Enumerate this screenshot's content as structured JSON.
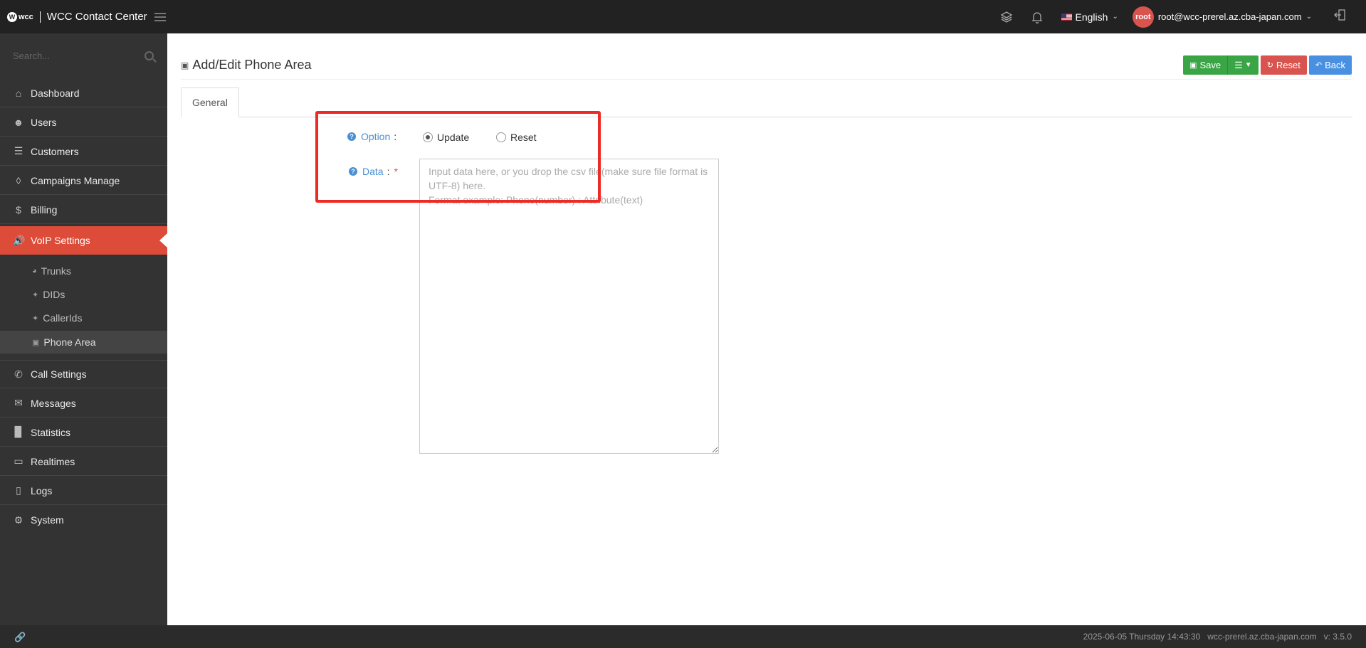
{
  "app": {
    "logo_text": "wcc",
    "title": "WCC Contact Center"
  },
  "topbar": {
    "language": "English",
    "avatar_text": "root",
    "user_email": "root@wcc-prerel.az.cba-japan.com"
  },
  "sidebar": {
    "search_placeholder": "Search...",
    "items": [
      {
        "label": "Dashboard",
        "icon": "home-icon"
      },
      {
        "label": "Users",
        "icon": "user-icon"
      },
      {
        "label": "Customers",
        "icon": "database-icon"
      },
      {
        "label": "Campaigns Manage",
        "icon": "layers-icon"
      },
      {
        "label": "Billing",
        "icon": "dollar-icon"
      },
      {
        "label": "VoIP Settings",
        "icon": "volume-icon",
        "active": true
      },
      {
        "label": "Call Settings",
        "icon": "phone-icon"
      },
      {
        "label": "Messages",
        "icon": "envelope-icon"
      },
      {
        "label": "Statistics",
        "icon": "bar-chart-icon"
      },
      {
        "label": "Realtimes",
        "icon": "monitor-icon"
      },
      {
        "label": "Logs",
        "icon": "book-icon"
      },
      {
        "label": "System",
        "icon": "gear-icon"
      }
    ],
    "subitems": [
      {
        "label": "Trunks",
        "icon": "tachometer-icon"
      },
      {
        "label": "DIDs",
        "icon": "crosshair-icon"
      },
      {
        "label": "CallerIds",
        "icon": "crosshair-icon"
      },
      {
        "label": "Phone Area",
        "icon": "book-icon",
        "active": true
      }
    ]
  },
  "page": {
    "title": "Add/Edit Phone Area",
    "buttons": {
      "save": "Save",
      "reset": "Reset",
      "back": "Back"
    },
    "tab": "General",
    "form": {
      "option_label": "Option",
      "option_values": [
        "Update",
        "Reset"
      ],
      "option_selected": "Update",
      "data_label": "Data",
      "data_required_mark": "*",
      "data_placeholder": "Input data here, or you drop the csv file(make sure file format is UTF-8) here.\nFormat example: Phone(number) : Attribute(text)"
    }
  },
  "footer": {
    "datetime": "2025-06-05 Thursday 14:43:30",
    "host": "wcc-prerel.az.cba-japan.com",
    "version": "v: 3.5.0"
  },
  "colors": {
    "accent_red": "#dd4b39",
    "save_green": "#3aa545",
    "back_blue": "#4a90e2",
    "highlight": "#ee2a24"
  }
}
